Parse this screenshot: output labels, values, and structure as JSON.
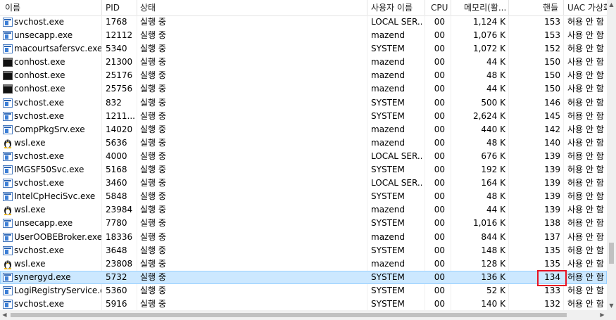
{
  "columns": {
    "name": "이름",
    "pid": "PID",
    "status": "상태",
    "user": "사용자 이름",
    "cpu": "CPU",
    "memory": "메모리(활...",
    "handles": "핸들",
    "uac": "UAC 가상화"
  },
  "rows": [
    {
      "icon": "service-icon",
      "name": "svchost.exe",
      "pid": "1768",
      "status": "실행 중",
      "user": "LOCAL SER...",
      "cpu": "00",
      "memory": "1,124 K",
      "handles": "153",
      "uac": "허용 안 함"
    },
    {
      "icon": "service-icon",
      "name": "unsecapp.exe",
      "pid": "12112",
      "status": "실행 중",
      "user": "mazend",
      "cpu": "00",
      "memory": "1,076 K",
      "handles": "153",
      "uac": "사용 안 함"
    },
    {
      "icon": "service-icon",
      "name": "macourtsafersvc.exe",
      "pid": "5340",
      "status": "실행 중",
      "user": "SYSTEM",
      "cpu": "00",
      "memory": "1,072 K",
      "handles": "152",
      "uac": "허용 안 함"
    },
    {
      "icon": "console-icon",
      "name": "conhost.exe",
      "pid": "21300",
      "status": "실행 중",
      "user": "mazend",
      "cpu": "00",
      "memory": "44 K",
      "handles": "150",
      "uac": "사용 안 함"
    },
    {
      "icon": "console-icon",
      "name": "conhost.exe",
      "pid": "25176",
      "status": "실행 중",
      "user": "mazend",
      "cpu": "00",
      "memory": "48 K",
      "handles": "150",
      "uac": "사용 안 함"
    },
    {
      "icon": "console-icon",
      "name": "conhost.exe",
      "pid": "25756",
      "status": "실행 중",
      "user": "mazend",
      "cpu": "00",
      "memory": "44 K",
      "handles": "150",
      "uac": "사용 안 함"
    },
    {
      "icon": "service-icon",
      "name": "svchost.exe",
      "pid": "832",
      "status": "실행 중",
      "user": "SYSTEM",
      "cpu": "00",
      "memory": "500 K",
      "handles": "146",
      "uac": "허용 안 함"
    },
    {
      "icon": "service-icon",
      "name": "svchost.exe",
      "pid": "1211...",
      "status": "실행 중",
      "user": "SYSTEM",
      "cpu": "00",
      "memory": "2,624 K",
      "handles": "145",
      "uac": "허용 안 함"
    },
    {
      "icon": "service-icon",
      "name": "CompPkgSrv.exe",
      "pid": "14020",
      "status": "실행 중",
      "user": "mazend",
      "cpu": "00",
      "memory": "440 K",
      "handles": "142",
      "uac": "사용 안 함"
    },
    {
      "icon": "penguin-icon",
      "name": "wsl.exe",
      "pid": "5636",
      "status": "실행 중",
      "user": "mazend",
      "cpu": "00",
      "memory": "48 K",
      "handles": "140",
      "uac": "사용 안 함"
    },
    {
      "icon": "service-icon",
      "name": "svchost.exe",
      "pid": "4000",
      "status": "실행 중",
      "user": "LOCAL SER...",
      "cpu": "00",
      "memory": "676 K",
      "handles": "139",
      "uac": "허용 안 함"
    },
    {
      "icon": "service-icon",
      "name": "IMGSF50Svc.exe",
      "pid": "5168",
      "status": "실행 중",
      "user": "SYSTEM",
      "cpu": "00",
      "memory": "192 K",
      "handles": "139",
      "uac": "허용 안 함"
    },
    {
      "icon": "service-icon",
      "name": "svchost.exe",
      "pid": "3460",
      "status": "실행 중",
      "user": "LOCAL SER...",
      "cpu": "00",
      "memory": "164 K",
      "handles": "139",
      "uac": "허용 안 함"
    },
    {
      "icon": "service-icon",
      "name": "IntelCpHeciSvc.exe",
      "pid": "5848",
      "status": "실행 중",
      "user": "SYSTEM",
      "cpu": "00",
      "memory": "48 K",
      "handles": "139",
      "uac": "허용 안 함"
    },
    {
      "icon": "penguin-icon",
      "name": "wsl.exe",
      "pid": "23984",
      "status": "실행 중",
      "user": "mazend",
      "cpu": "00",
      "memory": "44 K",
      "handles": "139",
      "uac": "사용 안 함"
    },
    {
      "icon": "service-icon",
      "name": "unsecapp.exe",
      "pid": "7780",
      "status": "실행 중",
      "user": "SYSTEM",
      "cpu": "00",
      "memory": "1,016 K",
      "handles": "138",
      "uac": "허용 안 함"
    },
    {
      "icon": "service-icon",
      "name": "UserOOBEBroker.exe",
      "pid": "18336",
      "status": "실행 중",
      "user": "mazend",
      "cpu": "00",
      "memory": "844 K",
      "handles": "137",
      "uac": "사용 안 함"
    },
    {
      "icon": "service-icon",
      "name": "svchost.exe",
      "pid": "3648",
      "status": "실행 중",
      "user": "SYSTEM",
      "cpu": "00",
      "memory": "148 K",
      "handles": "135",
      "uac": "허용 안 함"
    },
    {
      "icon": "penguin-icon",
      "name": "wsl.exe",
      "pid": "23808",
      "status": "실행 중",
      "user": "mazend",
      "cpu": "00",
      "memory": "128 K",
      "handles": "135",
      "uac": "사용 안 함"
    },
    {
      "icon": "service-icon",
      "name": "synergyd.exe",
      "pid": "5732",
      "status": "실행 중",
      "user": "SYSTEM",
      "cpu": "00",
      "memory": "136 K",
      "handles": "134",
      "uac": "허용 안 함",
      "selected": true
    },
    {
      "icon": "service-icon",
      "name": "LogiRegistryService.e...",
      "pid": "5360",
      "status": "실행 중",
      "user": "SYSTEM",
      "cpu": "00",
      "memory": "52 K",
      "handles": "133",
      "uac": "허용 안 함"
    },
    {
      "icon": "service-icon",
      "name": "svchost.exe",
      "pid": "5916",
      "status": "실행 중",
      "user": "SYSTEM",
      "cpu": "00",
      "memory": "140 K",
      "handles": "132",
      "uac": "허용 안 함"
    }
  ],
  "colors": {
    "selection": "#cce8ff",
    "highlight_box": "#e81123"
  }
}
